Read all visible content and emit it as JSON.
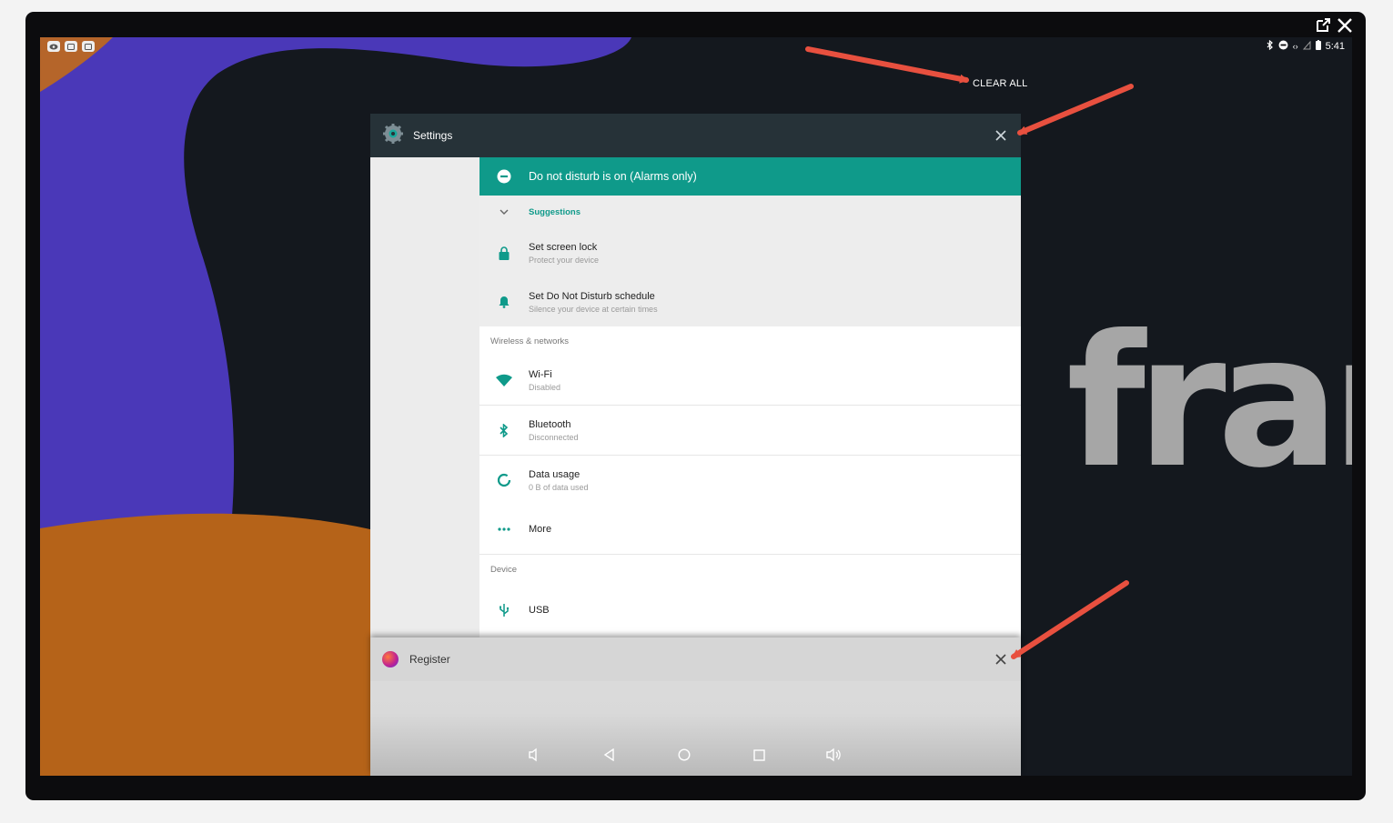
{
  "status_bar": {
    "time": "5:41",
    "left_icons": [
      "eye-icon",
      "notification-icon",
      "notification-icon"
    ],
    "right_icons": [
      "bluetooth-icon",
      "dnd-icon",
      "code-icon",
      "signal-icon",
      "battery-icon"
    ]
  },
  "recents": {
    "clear_all_label": "CLEAR ALL",
    "background_brand_text": "fran"
  },
  "settings_card": {
    "title": "Settings",
    "dnd_banner": "Do not disturb is on (Alarms only)",
    "suggestions_title": "Suggestions",
    "suggestions": [
      {
        "title": "Set screen lock",
        "subtitle": "Protect your device",
        "icon": "lock-icon"
      },
      {
        "title": "Set Do Not Disturb schedule",
        "subtitle": "Silence your device at certain times",
        "icon": "bell-icon"
      }
    ],
    "sections": {
      "wireless": "Wireless & networks",
      "device": "Device"
    },
    "wireless_items": [
      {
        "title": "Wi-Fi",
        "subtitle": "Disabled",
        "icon": "wifi-icon"
      },
      {
        "title": "Bluetooth",
        "subtitle": "Disconnected",
        "icon": "bluetooth-icon"
      },
      {
        "title": "Data usage",
        "subtitle": "0 B of data used",
        "icon": "data-usage-icon"
      },
      {
        "title": "More",
        "subtitle": "",
        "icon": "more-icon"
      }
    ],
    "device_items": [
      {
        "title": "USB",
        "icon": "usb-icon"
      }
    ]
  },
  "register_card": {
    "title": "Register"
  },
  "nav_bar": [
    "volume-down-icon",
    "back-icon",
    "home-icon",
    "recents-icon",
    "volume-up-icon"
  ],
  "colors": {
    "accent": "#0f9a8a",
    "header_dark": "#263238",
    "annotation_arrow": "#e8503f"
  }
}
